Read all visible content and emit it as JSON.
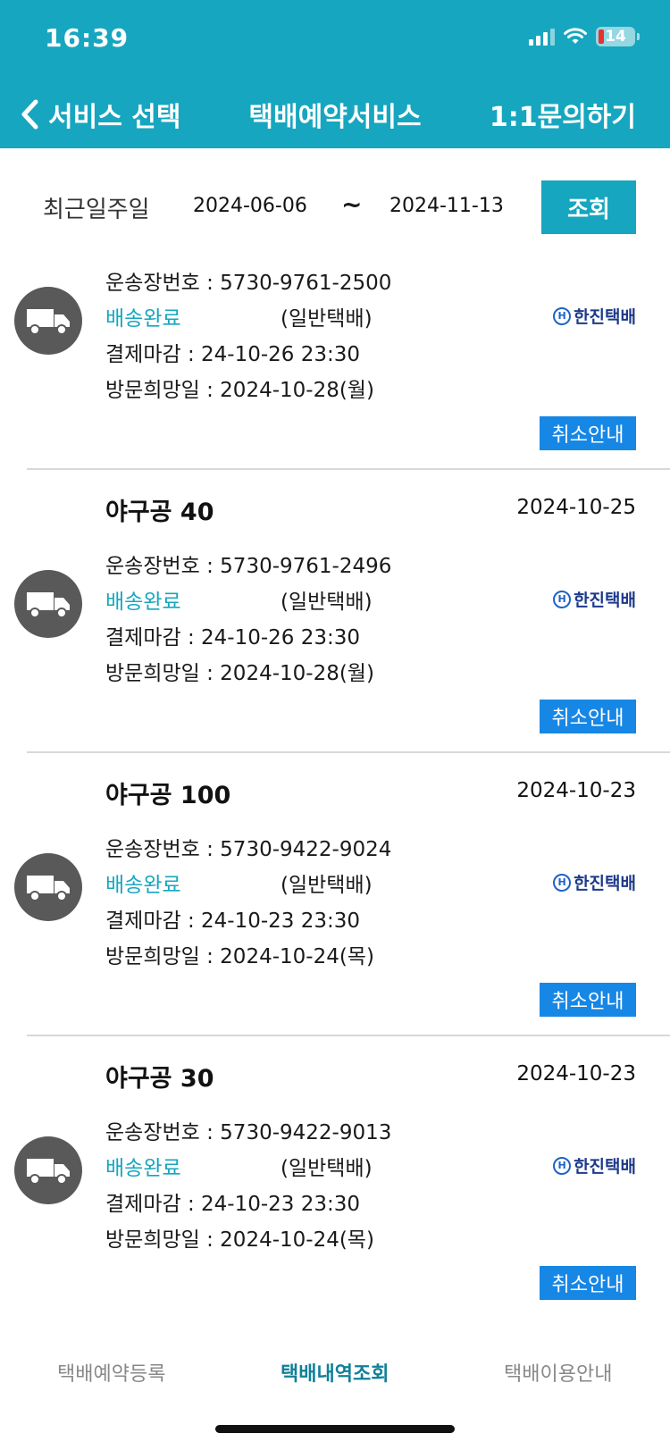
{
  "status_bar": {
    "time": "16:39",
    "battery": "14"
  },
  "nav": {
    "back_label": "서비스 선택",
    "title": "택배예약서비스",
    "inquiry_label": "1:1문의하기"
  },
  "filter": {
    "label": "최근일주일",
    "start_date": "2024-06-06",
    "tilde": "~",
    "end_date": "2024-11-13",
    "search_label": "조회"
  },
  "items": [
    {
      "title": "",
      "date": "",
      "waybill": "운송장번호 : 5730-9761-2500",
      "status": "배송완료",
      "service_type": "(일반택배)",
      "carrier": "한진택배",
      "payment_deadline": "결제마감 : 24-10-26 23:30",
      "visit_date": "방문희망일 : 2024-10-28(월)",
      "cancel_label": "취소안내"
    },
    {
      "title": "야구공 40",
      "date": "2024-10-25",
      "waybill": "운송장번호 : 5730-9761-2496",
      "status": "배송완료",
      "service_type": "(일반택배)",
      "carrier": "한진택배",
      "payment_deadline": "결제마감 : 24-10-26 23:30",
      "visit_date": "방문희망일 : 2024-10-28(월)",
      "cancel_label": "취소안내"
    },
    {
      "title": "야구공 100",
      "date": "2024-10-23",
      "waybill": "운송장번호 : 5730-9422-9024",
      "status": "배송완료",
      "service_type": "(일반택배)",
      "carrier": "한진택배",
      "payment_deadline": "결제마감 : 24-10-23 23:30",
      "visit_date": "방문희망일 : 2024-10-24(목)",
      "cancel_label": "취소안내"
    },
    {
      "title": "야구공 30",
      "date": "2024-10-23",
      "waybill": "운송장번호 : 5730-9422-9013",
      "status": "배송완료",
      "service_type": "(일반택배)",
      "carrier": "한진택배",
      "payment_deadline": "결제마감 : 24-10-23 23:30",
      "visit_date": "방문희망일 : 2024-10-24(목)",
      "cancel_label": "취소안내"
    }
  ],
  "tabs": [
    {
      "label": "택배예약등록",
      "active": false
    },
    {
      "label": "택배내역조회",
      "active": true
    },
    {
      "label": "택배이용안내",
      "active": false
    }
  ],
  "icons": {
    "back": "chevron-left-icon",
    "truck": "truck-icon",
    "carrier_logo": "hanjin-logo-icon",
    "wifi": "wifi-icon",
    "signal": "signal-icon",
    "battery": "battery-icon"
  },
  "colors": {
    "header": "#17a6bf",
    "status_text": "#17a6bf",
    "cancel_button": "#1787e6",
    "active_tab": "#10809a"
  }
}
